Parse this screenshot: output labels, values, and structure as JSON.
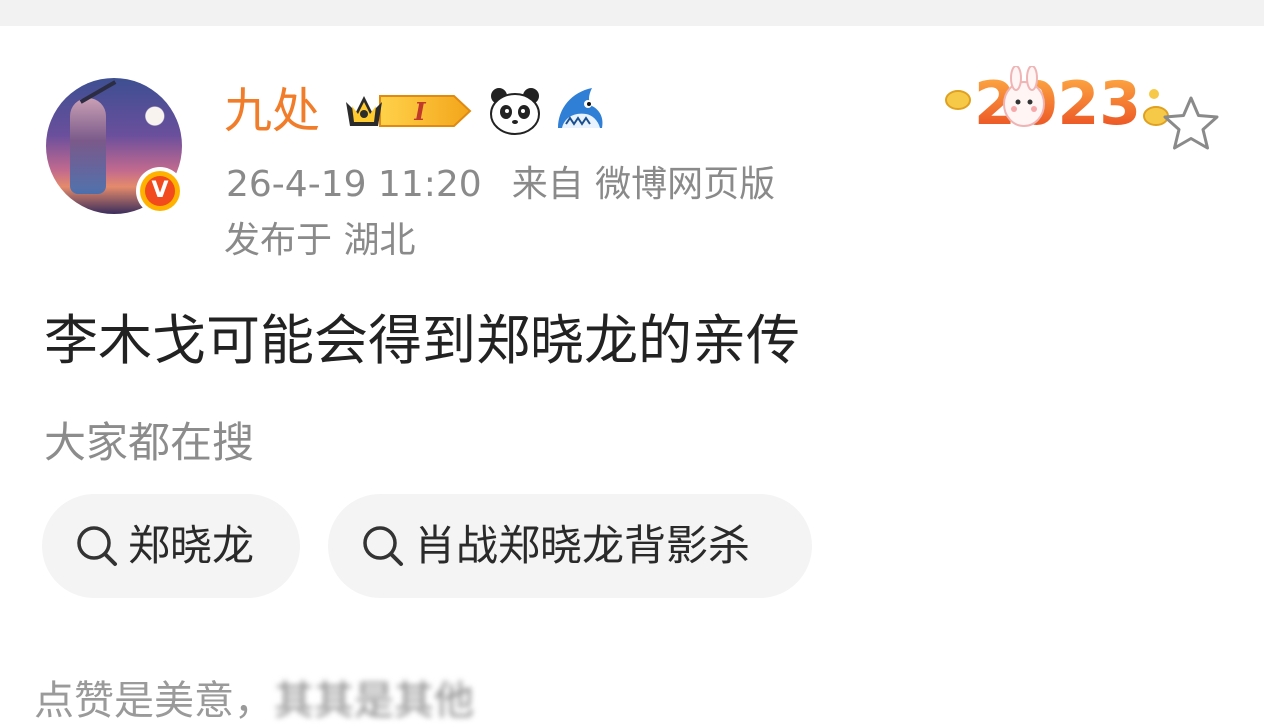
{
  "user": {
    "name": "九处",
    "member_badge_text": "I",
    "badges": [
      "crown-member-icon",
      "panda-icon",
      "shark-icon"
    ],
    "verified_letter": "V"
  },
  "post_meta": {
    "time": "26-4-19 11:20",
    "source": "来自 微博网页版",
    "location": "发布于 湖北"
  },
  "card_decoration": {
    "year_badge": "2023"
  },
  "post": {
    "text": "李木戈可能会得到郑晓龙的亲传"
  },
  "trending": {
    "label": "大家都在搜",
    "chips": [
      {
        "label": "郑晓龙",
        "icon": "search-icon"
      },
      {
        "label": "肖战郑晓龙背影杀",
        "icon": "search-icon"
      }
    ]
  },
  "footer": {
    "text": "点赞是美意，",
    "blurred_text": "其其是其他"
  },
  "colors": {
    "username": "#f17d2a",
    "meta_text": "#8a8a8a",
    "body_text": "#222222",
    "chip_bg": "#f4f4f4",
    "verified_badge": "#f24a1d"
  }
}
